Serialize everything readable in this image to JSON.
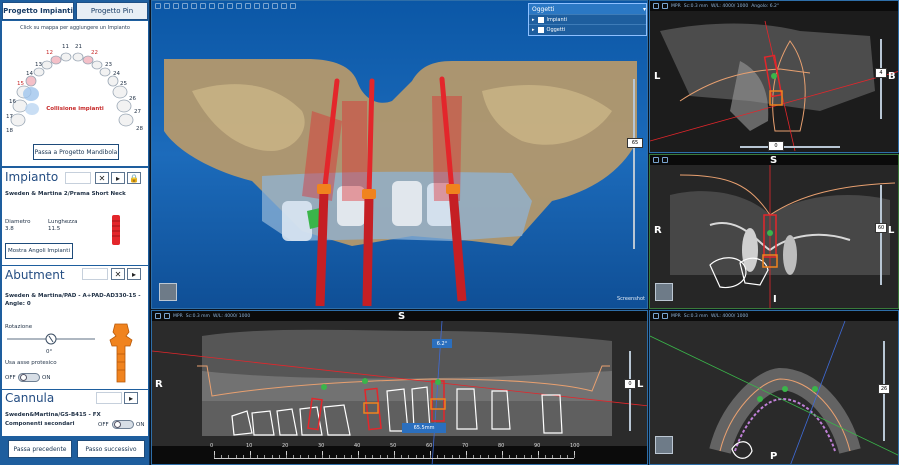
{
  "left_panel": {
    "tabs": [
      "Progetto Impianti",
      "Progetto Pin"
    ],
    "hint": "Click su mappa per aggiungere un Impianto",
    "tooth_numbers": [
      "18",
      "17",
      "16",
      "15",
      "14",
      "13",
      "12",
      "11",
      "21",
      "22",
      "23",
      "24",
      "25",
      "26",
      "27",
      "28"
    ],
    "collision_label": "Collisione impianti",
    "switch_button": "Passa a Progetto Mandibola",
    "implant": {
      "title": "Impianto",
      "model": "Sweden & Martina 2/Prama Short Neck",
      "diameter_label": "Diametro",
      "diameter_value": "3.8",
      "length_label": "Lunghezza",
      "length_value": "11.5",
      "show_angles_button": "Mostra Angoli Impianti"
    },
    "abutment": {
      "title": "Abutment",
      "model": "Sweden & Martina/PAD - A+PAD-AD330-15 - Angle: 0",
      "rotation_label": "Rotazione",
      "rotation_value": "0°",
      "use_axis_label": "Usa asse protesico",
      "toggle_off": "OFF",
      "toggle_on": "ON"
    },
    "cannula": {
      "title": "Cannula",
      "model": "Sweden&Martina/GS-B415 - FX",
      "secondary_label": "Componenti secondari",
      "toggle_off": "OFF",
      "toggle_on": "ON"
    },
    "prev_button": "Passa precedente",
    "next_button": "Passo successivo"
  },
  "oggetti": {
    "title": "Oggetti",
    "items": [
      "Impianti",
      "Oggetti"
    ]
  },
  "view3d": {
    "slider_value": "65",
    "screenshot_label": "Screenshot"
  },
  "view_sagittal": {
    "toolbar": [
      "MPR",
      "Sc:0.3 mm",
      "W/L: 4000/ 1000",
      "Angolo: 6.2°"
    ],
    "left": "L",
    "right": "B",
    "slider_value": "4",
    "bottom_value": "0"
  },
  "view_coronal": {
    "left": "R",
    "right": "L",
    "top": "S",
    "bottom": "I",
    "slider_value": "60"
  },
  "view_panoramic": {
    "toolbar": [
      "MPR",
      "Sc:0.3 mm",
      "W/L: 4000/ 1000"
    ],
    "left": "R",
    "right": "L",
    "top": "S",
    "angle_label": "6.2°",
    "measure_label": "65.5mm",
    "slider_value": "0",
    "ruler_ticks": [
      "0",
      "10",
      "20",
      "30",
      "40",
      "50",
      "60",
      "70",
      "80",
      "90",
      "100"
    ]
  },
  "view_axial": {
    "toolbar": [
      "MPR",
      "Sc:0.3 mm",
      "W/L: 4000/ 1000"
    ],
    "bottom": "P",
    "slider_value": "26"
  },
  "colors": {
    "panel_blue": "#1e5e9e",
    "implant_red": "#e3262b",
    "abutment_orange": "#f0831e"
  }
}
